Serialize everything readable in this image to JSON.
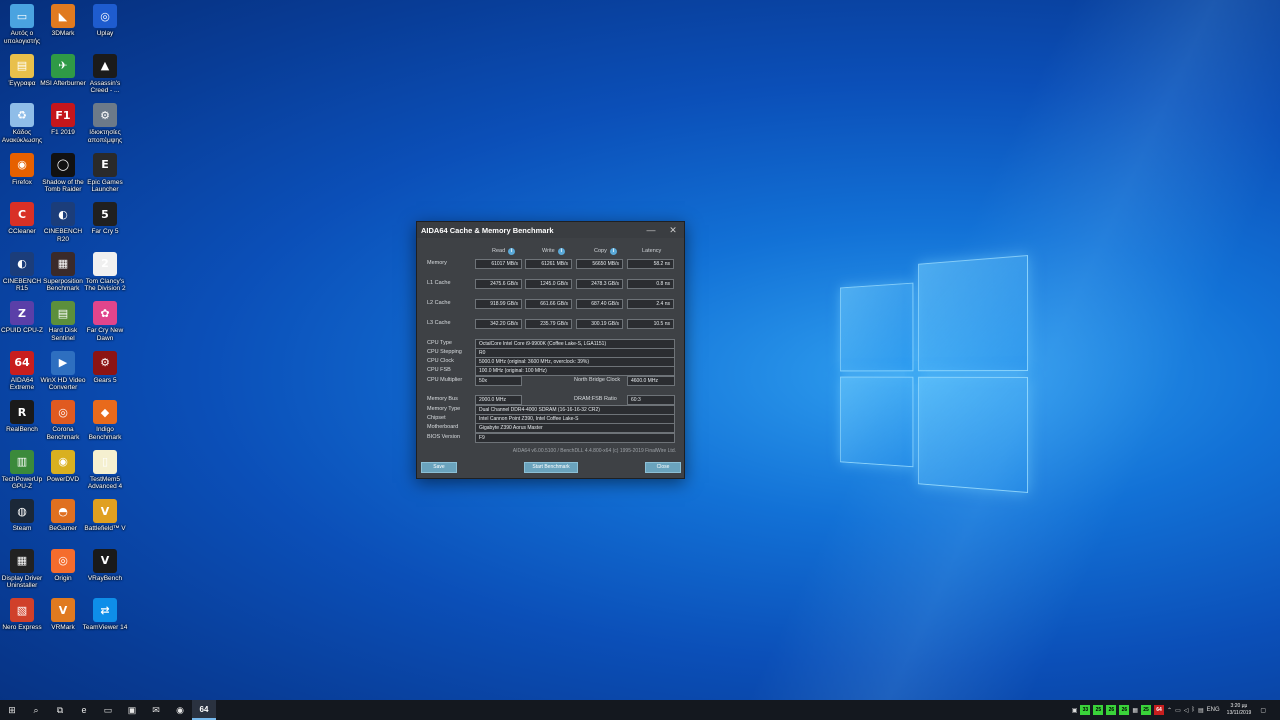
{
  "desktop": {
    "icons": [
      {
        "label": "Αυτός ο υπολογιστής",
        "icon": "computer-icon",
        "color": "#4aa3e0",
        "glyph": "▭"
      },
      {
        "label": "3DMark",
        "icon": "3dmark-icon",
        "color": "#e07a20",
        "glyph": "◣"
      },
      {
        "label": "Uplay",
        "icon": "uplay-icon",
        "color": "#1e5ccf",
        "glyph": "◎"
      },
      {
        "label": "Έγγραφα",
        "icon": "documents-folder-icon",
        "color": "#e9c04b",
        "glyph": "▤"
      },
      {
        "label": "MSI Afterburner",
        "icon": "msi-afterburner-icon",
        "color": "#2f9a46",
        "glyph": "✈"
      },
      {
        "label": "Assassin's Creed - ...",
        "icon": "assassins-creed-icon",
        "color": "#1b1b1b",
        "glyph": "▲"
      },
      {
        "label": "Κάδος Ανακύκλωσης",
        "icon": "recycle-bin-icon",
        "color": "#8fbde8",
        "glyph": "♻"
      },
      {
        "label": "F1 2019",
        "icon": "f1-2019-icon",
        "color": "#c4161c",
        "glyph": "F1"
      },
      {
        "label": "Ιδιοκτησίες αποπέμψης",
        "icon": "settings-shortcut-icon",
        "color": "#6c7a89",
        "glyph": "⚙"
      },
      {
        "label": "Firefox",
        "icon": "firefox-icon",
        "color": "#e66000",
        "glyph": "◉"
      },
      {
        "label": "Shadow of the Tomb Raider",
        "icon": "tomb-raider-icon",
        "color": "#111111",
        "glyph": "◯"
      },
      {
        "label": "Epic Games Launcher",
        "icon": "epic-games-icon",
        "color": "#2a2a2a",
        "glyph": "E"
      },
      {
        "label": "CCleaner",
        "icon": "ccleaner-icon",
        "color": "#d93026",
        "glyph": "C"
      },
      {
        "label": "CINEBENCH R20",
        "icon": "cinebench-r20-icon",
        "color": "#1b3d7a",
        "glyph": "◐"
      },
      {
        "label": "Far Cry 5",
        "icon": "far-cry-5-icon",
        "color": "#202020",
        "glyph": "5"
      },
      {
        "label": "CINEBENCH R15",
        "icon": "cinebench-r15-icon",
        "color": "#1b3d7a",
        "glyph": "◐"
      },
      {
        "label": "Superposition Benchmark",
        "icon": "superposition-icon",
        "color": "#3a2a2a",
        "glyph": "▦"
      },
      {
        "label": "Tom Clancy's The Division 2",
        "icon": "division-2-icon",
        "color": "#f0f0f0",
        "glyph": "2"
      },
      {
        "label": "CPUID CPU-Z",
        "icon": "cpu-z-icon",
        "color": "#5a3fa8",
        "glyph": "Z"
      },
      {
        "label": "Hard Disk Sentinel",
        "icon": "hard-disk-sentinel-icon",
        "color": "#5c8f3c",
        "glyph": "▤"
      },
      {
        "label": "Far Cry New Dawn",
        "icon": "far-cry-new-dawn-icon",
        "color": "#e0458c",
        "glyph": "✿"
      },
      {
        "label": "AIDA64 Extreme",
        "icon": "aida64-icon",
        "color": "#c81e1e",
        "glyph": "64"
      },
      {
        "label": "WinX HD Video Converter",
        "icon": "winx-converter-icon",
        "color": "#2e6fc0",
        "glyph": "▶"
      },
      {
        "label": "Gears 5",
        "icon": "gears-5-icon",
        "color": "#8c1414",
        "glyph": "⚙"
      },
      {
        "label": "RealBench",
        "icon": "realbench-icon",
        "color": "#1a1a1a",
        "glyph": "R"
      },
      {
        "label": "Corona Benchmark",
        "icon": "corona-benchmark-icon",
        "color": "#e05a20",
        "glyph": "◎"
      },
      {
        "label": "Indigo Benchmark",
        "icon": "indigo-benchmark-icon",
        "color": "#e86a1c",
        "glyph": "◆"
      },
      {
        "label": "TechPowerUp GPU-Z",
        "icon": "gpu-z-icon",
        "color": "#3b8a3b",
        "glyph": "▥"
      },
      {
        "label": "PowerDVD",
        "icon": "powerdvd-icon",
        "color": "#d9b020",
        "glyph": "◉"
      },
      {
        "label": "TestMem5 Advanced 4",
        "icon": "testmem5-icon",
        "color": "#f5f0d0",
        "glyph": "▯"
      },
      {
        "label": "Steam",
        "icon": "steam-icon",
        "color": "#1b2838",
        "glyph": "◍"
      },
      {
        "label": "BeGamer",
        "icon": "begamer-icon",
        "color": "#e07020",
        "glyph": "◓"
      },
      {
        "label": "Battlefield™ V",
        "icon": "battlefield-v-icon",
        "color": "#e0a020",
        "glyph": "V"
      },
      {
        "label": "Display Driver Uninstaller",
        "icon": "ddu-icon",
        "color": "#222222",
        "glyph": "▦"
      },
      {
        "label": "Origin",
        "icon": "origin-icon",
        "color": "#f56c2d",
        "glyph": "◎"
      },
      {
        "label": "VRayBench",
        "icon": "vraybench-icon",
        "color": "#1a1a1a",
        "glyph": "V"
      },
      {
        "label": "Nero Express",
        "icon": "nero-express-icon",
        "color": "#d0402a",
        "glyph": "▧"
      },
      {
        "label": "VRMark",
        "icon": "vrmark-icon",
        "color": "#e07a20",
        "glyph": "V"
      },
      {
        "label": "TeamViewer 14",
        "icon": "teamviewer-icon",
        "color": "#0e8ee9",
        "glyph": "⇄"
      }
    ]
  },
  "dialog": {
    "title": "AIDA64 Cache & Memory Benchmark",
    "columns": {
      "read": "Read",
      "write": "Write",
      "copy": "Copy",
      "latency": "Latency"
    },
    "rows": [
      {
        "label": "Memory",
        "read": "61017 MB/s",
        "write": "61261 MB/s",
        "copy": "56650 MB/s",
        "latency": "58.2 ns"
      },
      {
        "label": "L1 Cache",
        "read": "2475.6 GB/s",
        "write": "1245.0 GB/s",
        "copy": "2478.3 GB/s",
        "latency": "0.8 ns"
      },
      {
        "label": "L2 Cache",
        "read": "918.99 GB/s",
        "write": "661.66 GB/s",
        "copy": "687.40 GB/s",
        "latency": "2.4 ns"
      },
      {
        "label": "L3 Cache",
        "read": "342.20 GB/s",
        "write": "235.79 GB/s",
        "copy": "300.19 GB/s",
        "latency": "10.5 ns"
      }
    ],
    "cpu": {
      "type_label": "CPU Type",
      "type": "OctalCore Intel Core i9-9900K  (Coffee Lake-S, LGA1151)",
      "stepping_label": "CPU Stepping",
      "stepping": "R0",
      "clock_label": "CPU Clock",
      "clock": "5000.0 MHz  (original: 3600 MHz, overclock: 39%)",
      "fsb_label": "CPU FSB",
      "fsb": "100.0 MHz  (original: 100 MHz)",
      "multiplier_label": "CPU Multiplier",
      "multiplier": "50x",
      "nb_clock_label": "North Bridge Clock",
      "nb_clock": "4600.0 MHz"
    },
    "mem": {
      "bus_label": "Memory Bus",
      "bus": "2000.0 MHz",
      "ratio_label": "DRAM:FSB Ratio",
      "ratio": "60:3",
      "type_label": "Memory Type",
      "type": "Dual Channel DDR4-4000 SDRAM  (16-16-16-32 CR2)",
      "chipset_label": "Chipset",
      "chipset": "Intel Cannon Point Z390, Intel Coffee Lake-S",
      "mobo_label": "Motherboard",
      "mobo": "Gigabyte Z390 Aorus Master",
      "bios_label": "BIOS Version",
      "bios": "F9"
    },
    "footer": "AIDA64 v6.00.5100 / BenchDLL 4.4.800-x64  (c) 1995-2019 FinalWire Ltd.",
    "buttons": {
      "save": "Save",
      "start": "Start Benchmark",
      "close": "Close"
    },
    "window_buttons": {
      "minimize": "—",
      "close": "✕"
    }
  },
  "taskbar": {
    "items": [
      {
        "name": "start-button",
        "glyph": "⊞"
      },
      {
        "name": "search-icon",
        "glyph": "⌕"
      },
      {
        "name": "task-view-icon",
        "glyph": "⧉"
      },
      {
        "name": "edge-icon",
        "glyph": "e"
      },
      {
        "name": "file-explorer-icon",
        "glyph": "▭"
      },
      {
        "name": "store-icon",
        "glyph": "▣"
      },
      {
        "name": "mail-icon",
        "glyph": "✉"
      },
      {
        "name": "firefox-icon",
        "glyph": "◉"
      },
      {
        "name": "aida64-icon",
        "glyph": "64"
      }
    ],
    "tray_numbers": [
      "33",
      "25",
      "26",
      "26",
      "25"
    ],
    "language": "ENG",
    "time": "3:20 μμ",
    "date": "13/11/2019"
  }
}
